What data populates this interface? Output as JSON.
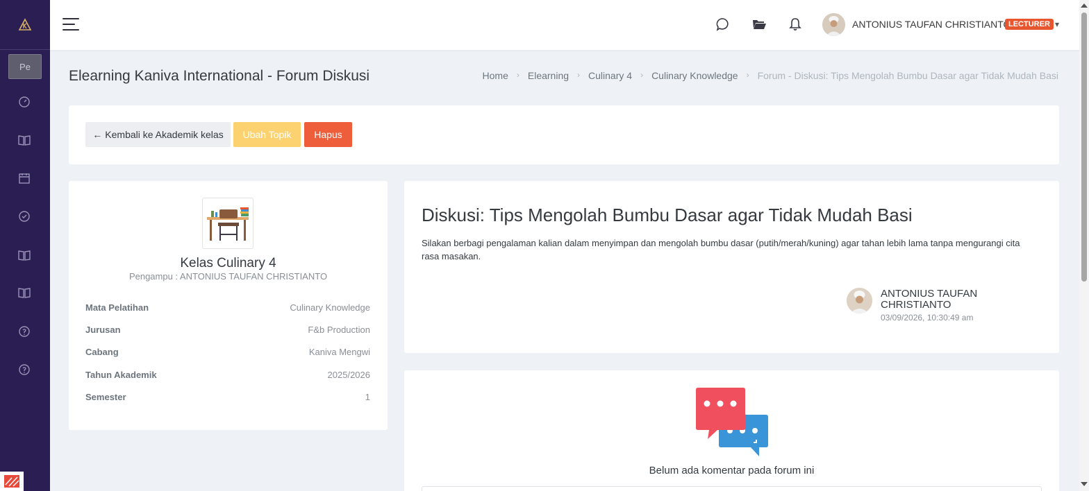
{
  "colors": {
    "sidebar_bg": "#2b1e52",
    "accent_orange": "#e8562f",
    "warning": "#fcd270",
    "danger": "#ef5e3b",
    "page_bg": "#eef2f6"
  },
  "sidebar": {
    "logo_icon": "kaniva-logo-icon",
    "profile_short": "Pe",
    "items": [
      {
        "icon": "dashboard-icon"
      },
      {
        "icon": "book-icon"
      },
      {
        "icon": "calendar-icon"
      },
      {
        "icon": "check-circle-icon"
      },
      {
        "icon": "book-icon"
      },
      {
        "icon": "book-icon"
      },
      {
        "icon": "help-icon"
      },
      {
        "icon": "help-icon"
      }
    ]
  },
  "topbar": {
    "menu_icon": "hamburger-icon",
    "icons": [
      "chat-icon",
      "folder-icon",
      "bell-icon"
    ],
    "user_name": "ANTONIUS TAUFAN CHRISTIANTO",
    "user_role": "LECTURER"
  },
  "page": {
    "title": "Elearning Kaniva International - Forum Diskusi",
    "breadcrumb": [
      "Home",
      "Elearning",
      "Culinary 4",
      "Culinary Knowledge",
      "Forum - Diskusi: Tips Mengolah Bumbu Dasar agar Tidak Mudah Basi"
    ]
  },
  "actions": {
    "back_label": "Kembali ke Akademik kelas",
    "back_arrow": "←",
    "edit_label": "Ubah Topik",
    "delete_label": "Hapus"
  },
  "class_card": {
    "name": "Kelas Culinary 4",
    "teacher": "Pengampu : ANTONIUS TAUFAN CHRISTIANTO",
    "info": [
      {
        "label": "Mata Pelatihan",
        "value": "Culinary Knowledge"
      },
      {
        "label": "Jurusan",
        "value": "F&b Production"
      },
      {
        "label": "Cabang",
        "value": "Kaniva Mengwi"
      },
      {
        "label": "Tahun Akademik",
        "value": "2025/2026"
      },
      {
        "label": "Semester",
        "value": "1"
      }
    ]
  },
  "discussion": {
    "title": "Diskusi: Tips Mengolah Bumbu Dasar agar Tidak Mudah Basi",
    "body": "Silakan berbagi pengalaman kalian dalam menyimpan dan mengolah bumbu dasar (putih/merah/kuning) agar tahan lebih lama tanpa mengurangi cita rasa masakan.",
    "author": "ANTONIUS TAUFAN CHRISTIANTO",
    "date": "03/09/2026, 10:30:49 am"
  },
  "comments": {
    "empty_text": "Belum ada komentar pada forum ini"
  }
}
